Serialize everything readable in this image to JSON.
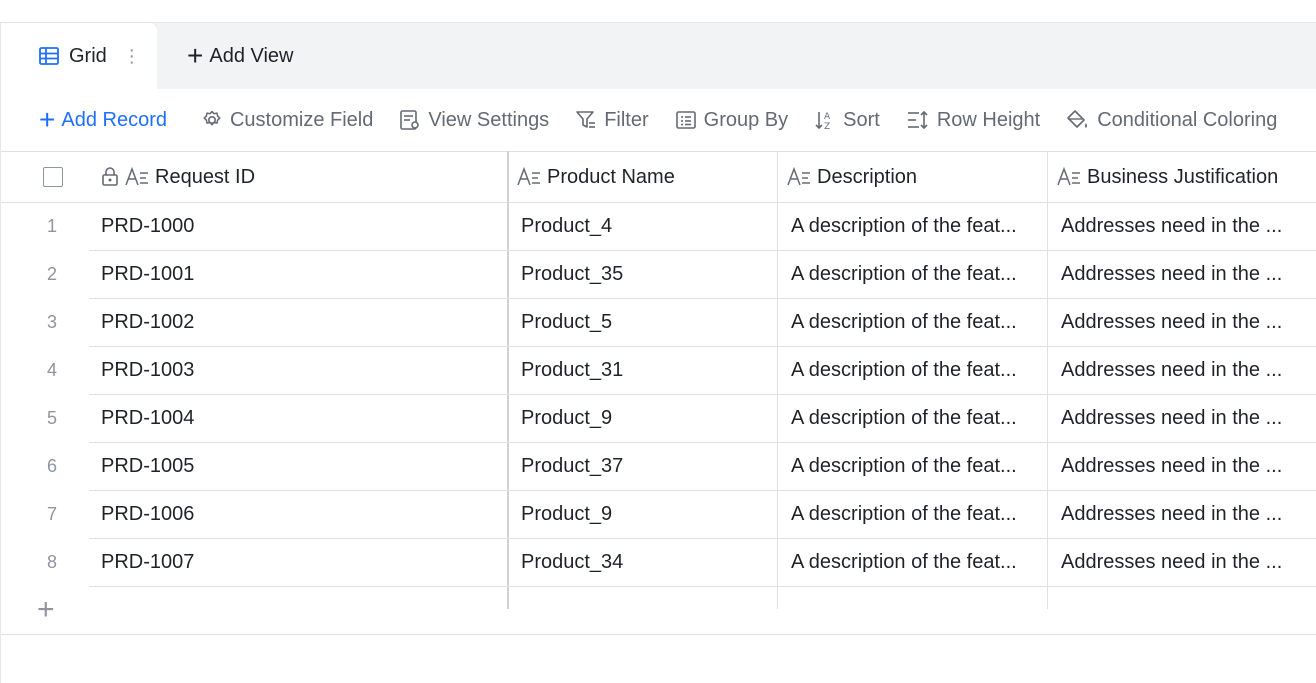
{
  "views": {
    "active_tab": "Grid",
    "add_view_label": "Add View"
  },
  "toolbar": {
    "add_record": "Add Record",
    "customize_field": "Customize Field",
    "view_settings": "View Settings",
    "filter": "Filter",
    "group_by": "Group By",
    "sort": "Sort",
    "row_height": "Row Height",
    "conditional_coloring": "Conditional Coloring"
  },
  "columns": [
    {
      "label": "Request ID",
      "locked": true
    },
    {
      "label": "Product Name"
    },
    {
      "label": "Description"
    },
    {
      "label": "Business Justification"
    }
  ],
  "rows": [
    {
      "num": "1",
      "request_id": "PRD-1000",
      "product": "Product_4",
      "description": "A description of the feat...",
      "justification": "Addresses need in the ..."
    },
    {
      "num": "2",
      "request_id": "PRD-1001",
      "product": "Product_35",
      "description": "A description of the feat...",
      "justification": "Addresses need in the ..."
    },
    {
      "num": "3",
      "request_id": "PRD-1002",
      "product": "Product_5",
      "description": "A description of the feat...",
      "justification": "Addresses need in the ..."
    },
    {
      "num": "4",
      "request_id": "PRD-1003",
      "product": "Product_31",
      "description": "A description of the feat...",
      "justification": "Addresses need in the ..."
    },
    {
      "num": "5",
      "request_id": "PRD-1004",
      "product": "Product_9",
      "description": "A description of the feat...",
      "justification": "Addresses need in the ..."
    },
    {
      "num": "6",
      "request_id": "PRD-1005",
      "product": "Product_37",
      "description": "A description of the feat...",
      "justification": "Addresses need in the ..."
    },
    {
      "num": "7",
      "request_id": "PRD-1006",
      "product": "Product_9",
      "description": "A description of the feat...",
      "justification": "Addresses need in the ..."
    },
    {
      "num": "8",
      "request_id": "PRD-1007",
      "product": "Product_34",
      "description": "A description of the feat...",
      "justification": "Addresses need in the ..."
    }
  ],
  "colors": {
    "accent": "#1f6fff",
    "text": "#1f2329",
    "muted": "#646a73",
    "border": "#dee0e3",
    "tabbar_bg": "#f2f3f5"
  }
}
